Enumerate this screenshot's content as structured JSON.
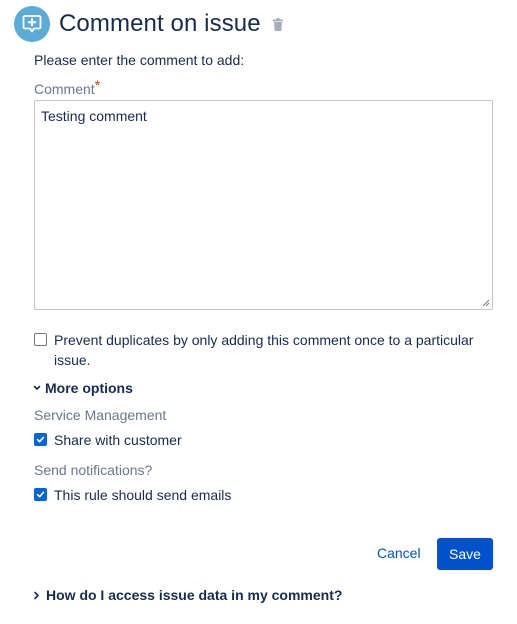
{
  "header": {
    "title": "Comment on issue",
    "icon": "comment-add-icon",
    "delete_icon": "trash-icon",
    "icon_color": "#5aabd8"
  },
  "form": {
    "prompt": "Please enter the comment to add:",
    "comment_label": "Comment",
    "required_marker": "*",
    "comment_value": "Testing comment",
    "prevent_duplicates": {
      "label": "Prevent duplicates by only adding this comment once to a particular",
      "label_cont": "issue.",
      "checked": false
    }
  },
  "more_options": {
    "label": "More options",
    "expanded": true,
    "service_management": {
      "section_label": "Service Management",
      "share_label": "Share with customer",
      "checked": true
    },
    "notifications": {
      "section_label": "Send notifications?",
      "send_emails_label": "This rule should send emails",
      "checked": true
    }
  },
  "actions": {
    "cancel_label": "Cancel",
    "save_label": "Save",
    "primary_color": "#0052cc"
  },
  "help": {
    "label": "How do I access issue data in my comment?",
    "expanded": false
  }
}
